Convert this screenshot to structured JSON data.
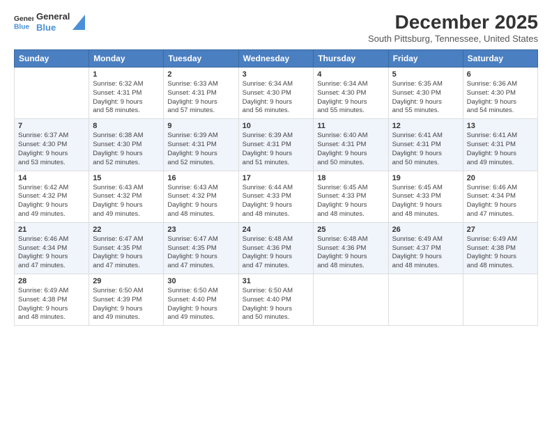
{
  "logo": {
    "line1": "General",
    "line2": "Blue"
  },
  "title": "December 2025",
  "subtitle": "South Pittsburg, Tennessee, United States",
  "weekdays": [
    "Sunday",
    "Monday",
    "Tuesday",
    "Wednesday",
    "Thursday",
    "Friday",
    "Saturday"
  ],
  "weeks": [
    [
      {
        "day": "",
        "detail": ""
      },
      {
        "day": "1",
        "detail": "Sunrise: 6:32 AM\nSunset: 4:31 PM\nDaylight: 9 hours\nand 58 minutes."
      },
      {
        "day": "2",
        "detail": "Sunrise: 6:33 AM\nSunset: 4:31 PM\nDaylight: 9 hours\nand 57 minutes."
      },
      {
        "day": "3",
        "detail": "Sunrise: 6:34 AM\nSunset: 4:30 PM\nDaylight: 9 hours\nand 56 minutes."
      },
      {
        "day": "4",
        "detail": "Sunrise: 6:34 AM\nSunset: 4:30 PM\nDaylight: 9 hours\nand 55 minutes."
      },
      {
        "day": "5",
        "detail": "Sunrise: 6:35 AM\nSunset: 4:30 PM\nDaylight: 9 hours\nand 55 minutes."
      },
      {
        "day": "6",
        "detail": "Sunrise: 6:36 AM\nSunset: 4:30 PM\nDaylight: 9 hours\nand 54 minutes."
      }
    ],
    [
      {
        "day": "7",
        "detail": "Sunrise: 6:37 AM\nSunset: 4:30 PM\nDaylight: 9 hours\nand 53 minutes."
      },
      {
        "day": "8",
        "detail": "Sunrise: 6:38 AM\nSunset: 4:30 PM\nDaylight: 9 hours\nand 52 minutes."
      },
      {
        "day": "9",
        "detail": "Sunrise: 6:39 AM\nSunset: 4:31 PM\nDaylight: 9 hours\nand 52 minutes."
      },
      {
        "day": "10",
        "detail": "Sunrise: 6:39 AM\nSunset: 4:31 PM\nDaylight: 9 hours\nand 51 minutes."
      },
      {
        "day": "11",
        "detail": "Sunrise: 6:40 AM\nSunset: 4:31 PM\nDaylight: 9 hours\nand 50 minutes."
      },
      {
        "day": "12",
        "detail": "Sunrise: 6:41 AM\nSunset: 4:31 PM\nDaylight: 9 hours\nand 50 minutes."
      },
      {
        "day": "13",
        "detail": "Sunrise: 6:41 AM\nSunset: 4:31 PM\nDaylight: 9 hours\nand 49 minutes."
      }
    ],
    [
      {
        "day": "14",
        "detail": "Sunrise: 6:42 AM\nSunset: 4:32 PM\nDaylight: 9 hours\nand 49 minutes."
      },
      {
        "day": "15",
        "detail": "Sunrise: 6:43 AM\nSunset: 4:32 PM\nDaylight: 9 hours\nand 49 minutes."
      },
      {
        "day": "16",
        "detail": "Sunrise: 6:43 AM\nSunset: 4:32 PM\nDaylight: 9 hours\nand 48 minutes."
      },
      {
        "day": "17",
        "detail": "Sunrise: 6:44 AM\nSunset: 4:33 PM\nDaylight: 9 hours\nand 48 minutes."
      },
      {
        "day": "18",
        "detail": "Sunrise: 6:45 AM\nSunset: 4:33 PM\nDaylight: 9 hours\nand 48 minutes."
      },
      {
        "day": "19",
        "detail": "Sunrise: 6:45 AM\nSunset: 4:33 PM\nDaylight: 9 hours\nand 48 minutes."
      },
      {
        "day": "20",
        "detail": "Sunrise: 6:46 AM\nSunset: 4:34 PM\nDaylight: 9 hours\nand 47 minutes."
      }
    ],
    [
      {
        "day": "21",
        "detail": "Sunrise: 6:46 AM\nSunset: 4:34 PM\nDaylight: 9 hours\nand 47 minutes."
      },
      {
        "day": "22",
        "detail": "Sunrise: 6:47 AM\nSunset: 4:35 PM\nDaylight: 9 hours\nand 47 minutes."
      },
      {
        "day": "23",
        "detail": "Sunrise: 6:47 AM\nSunset: 4:35 PM\nDaylight: 9 hours\nand 47 minutes."
      },
      {
        "day": "24",
        "detail": "Sunrise: 6:48 AM\nSunset: 4:36 PM\nDaylight: 9 hours\nand 47 minutes."
      },
      {
        "day": "25",
        "detail": "Sunrise: 6:48 AM\nSunset: 4:36 PM\nDaylight: 9 hours\nand 48 minutes."
      },
      {
        "day": "26",
        "detail": "Sunrise: 6:49 AM\nSunset: 4:37 PM\nDaylight: 9 hours\nand 48 minutes."
      },
      {
        "day": "27",
        "detail": "Sunrise: 6:49 AM\nSunset: 4:38 PM\nDaylight: 9 hours\nand 48 minutes."
      }
    ],
    [
      {
        "day": "28",
        "detail": "Sunrise: 6:49 AM\nSunset: 4:38 PM\nDaylight: 9 hours\nand 48 minutes."
      },
      {
        "day": "29",
        "detail": "Sunrise: 6:50 AM\nSunset: 4:39 PM\nDaylight: 9 hours\nand 49 minutes."
      },
      {
        "day": "30",
        "detail": "Sunrise: 6:50 AM\nSunset: 4:40 PM\nDaylight: 9 hours\nand 49 minutes."
      },
      {
        "day": "31",
        "detail": "Sunrise: 6:50 AM\nSunset: 4:40 PM\nDaylight: 9 hours\nand 50 minutes."
      },
      {
        "day": "",
        "detail": ""
      },
      {
        "day": "",
        "detail": ""
      },
      {
        "day": "",
        "detail": ""
      }
    ]
  ]
}
